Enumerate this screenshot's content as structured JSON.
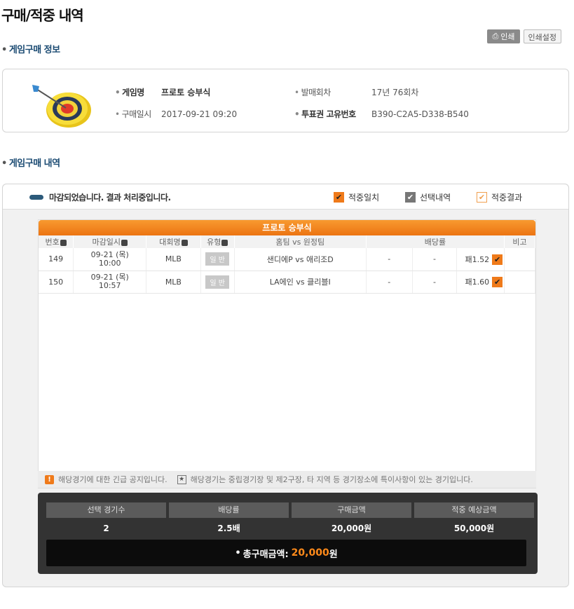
{
  "page_title": "구매/적중 내역",
  "sections": {
    "purchase_info": "게임구매 정보",
    "purchase_history": "게임구매 내역"
  },
  "print": {
    "print_label": "인쇄",
    "setting_label": "인쇄설정"
  },
  "info": {
    "game_name_label": "게임명",
    "game_name": "프로토 승부식",
    "round_label": "발매회차",
    "round": "17년 76회차",
    "date_label": "구매일시",
    "date": "2017-09-21 09:20",
    "ticket_label": "투표권 고유번호",
    "ticket": "B390-C2A5-D338-B540"
  },
  "status": {
    "message": "마감되었습니다. 결과 처리중입니다."
  },
  "legend": {
    "match": "적중일치",
    "selected": "선택내역",
    "result": "적중결과"
  },
  "table": {
    "title": "프로토 승부식",
    "headers": {
      "no": "번호",
      "deadline": "마감일시",
      "league": "대회명",
      "type": "유형",
      "teams": "홈팀 vs 원정팀",
      "odds": "배당률",
      "note": "비고"
    },
    "rows": [
      {
        "no": "149",
        "date": "09-21 (목)",
        "time": "10:00",
        "league": "MLB",
        "type": "일 반",
        "teams": "샌디에P vs 애리조D",
        "odds1": "-",
        "odds2": "-",
        "odds3": "패1.52",
        "note": ""
      },
      {
        "no": "150",
        "date": "09-21 (목)",
        "time": "10:57",
        "league": "MLB",
        "type": "일 반",
        "teams": "LA에인 vs 클리블I",
        "odds1": "-",
        "odds2": "-",
        "odds3": "패1.60",
        "note": ""
      }
    ]
  },
  "notice": {
    "urgent": "해당경기에 대한 긴급 공지입니다.",
    "special": "해당경기는 중립경기장 및 제2구장, 타 지역 등 경기장소에 특이사항이 있는 경기입니다."
  },
  "summary": {
    "headers": [
      "선택 경기수",
      "배당률",
      "구매금액",
      "적중 예상금액"
    ],
    "values": [
      "2",
      "2.5배",
      "20,000원",
      "50,000원"
    ],
    "total_label": "총구매금액:",
    "total_amount": "20,000",
    "total_unit": "원"
  },
  "colors": {
    "accent": "#ef7a1a",
    "title_blue": "#1a4a72",
    "summary_bg": "#333333"
  }
}
